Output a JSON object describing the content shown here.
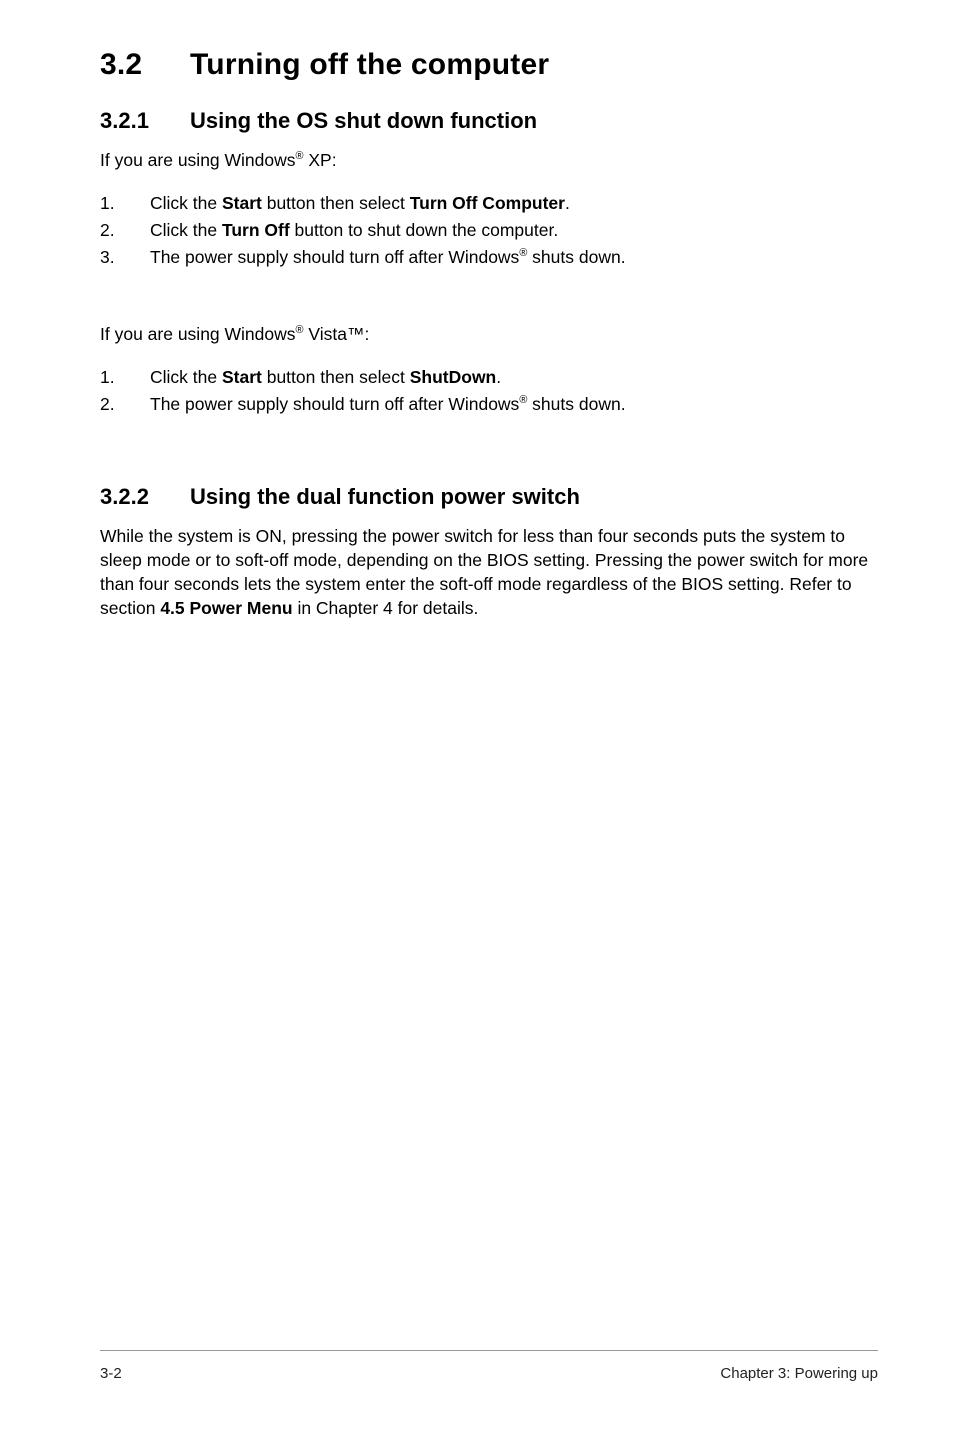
{
  "heading": {
    "num": "3.2",
    "title": "Turning off the computer"
  },
  "s1": {
    "num": "3.2.1",
    "title": "Using the OS shut down function",
    "intro_pre": "If you are using Windows",
    "intro_post": " XP:",
    "steps": [
      {
        "n": "1.",
        "pre": "Click the ",
        "b1": "Start",
        "mid": " button then select ",
        "b2": "Turn Off Computer",
        "post": "."
      },
      {
        "n": "2.",
        "pre": "Click the ",
        "b1": "Turn Off",
        "mid": " button to shut down the computer.",
        "b2": "",
        "post": ""
      },
      {
        "n": "3.",
        "pre": "The power supply should turn off after Windows",
        "sup": "®",
        "post": " shuts down."
      }
    ],
    "intro2_pre": "If you are using Windows",
    "intro2_sup": "®",
    "intro2_post": " Vista™:",
    "steps2": [
      {
        "n": "1.",
        "pre": "Click the ",
        "b1": "Start",
        "mid": " button then select ",
        "b2": "ShutDown",
        "post": "."
      },
      {
        "n": "2.",
        "pre": "The power supply should turn off after Windows",
        "sup": "®",
        "post": " shuts down."
      }
    ]
  },
  "s2": {
    "num": "3.2.2",
    "title": "Using the dual function power switch",
    "body_pre": "While the system is ON, pressing the power switch for less than four seconds puts the system to sleep mode or to soft-off mode, depending on the BIOS setting. Pressing the power switch for more than four seconds lets the system enter the soft-off mode regardless of the BIOS setting. Refer to section ",
    "body_bold": "4.5 Power Menu",
    "body_post": " in Chapter 4 for details."
  },
  "footer": {
    "left": "3-2",
    "right": "Chapter 3: Powering up"
  }
}
